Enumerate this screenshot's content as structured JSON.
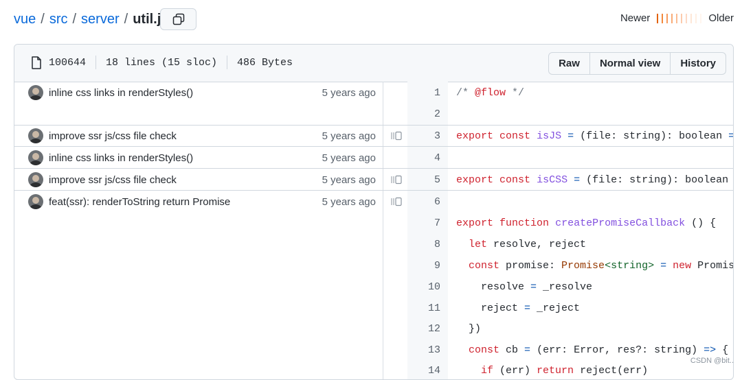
{
  "breadcrumb": {
    "parts": [
      "vue",
      "src",
      "server"
    ],
    "separator": "/",
    "file": "util.js"
  },
  "copy_icon": "copy-icon",
  "age_legend": {
    "newer": "Newer",
    "older": "Older",
    "colors": [
      "#e36209",
      "#f3883b",
      "#f79a5c",
      "#f9ab77",
      "#fbbb92",
      "#fccbad",
      "#fdd9c4",
      "#fee6d6",
      "#ffefe3",
      "#fff5ee"
    ]
  },
  "file_info": {
    "mode": "100644",
    "lines": "18 lines (15 sloc)",
    "size": "486 Bytes",
    "icon": "file-icon"
  },
  "buttons": {
    "raw": "Raw",
    "normal_view": "Normal view",
    "history": "History"
  },
  "commits": [
    {
      "message": "inline css links in renderStyles()",
      "age": "5 years ago"
    },
    {
      "message": "improve ssr js/css file check",
      "age": "5 years ago"
    },
    {
      "message": "inline css links in renderStyles()",
      "age": "5 years ago"
    },
    {
      "message": "improve ssr js/css file check",
      "age": "5 years ago"
    },
    {
      "message": "feat(ssr): renderToString return Promise",
      "age": "5 years ago"
    }
  ],
  "line_numbers": [
    "1",
    "2",
    "3",
    "4",
    "5",
    "6",
    "7",
    "8",
    "9",
    "10",
    "11",
    "12",
    "13",
    "14"
  ],
  "code_lines": [
    "/* @flow */",
    "",
    "export const isJS = (file: string): boolean =>",
    "",
    "export const isCSS = (file: string): boolean =>",
    "",
    "export function createPromiseCallback () {",
    "  let resolve, reject",
    "  const promise: Promise<string> = new Promise(",
    "    resolve = _resolve",
    "    reject = _reject",
    "  })",
    "  const cb = (err: Error, res?: string) => {",
    "    if (err) return reject(err)"
  ],
  "watermark": "CSDN @bit.."
}
